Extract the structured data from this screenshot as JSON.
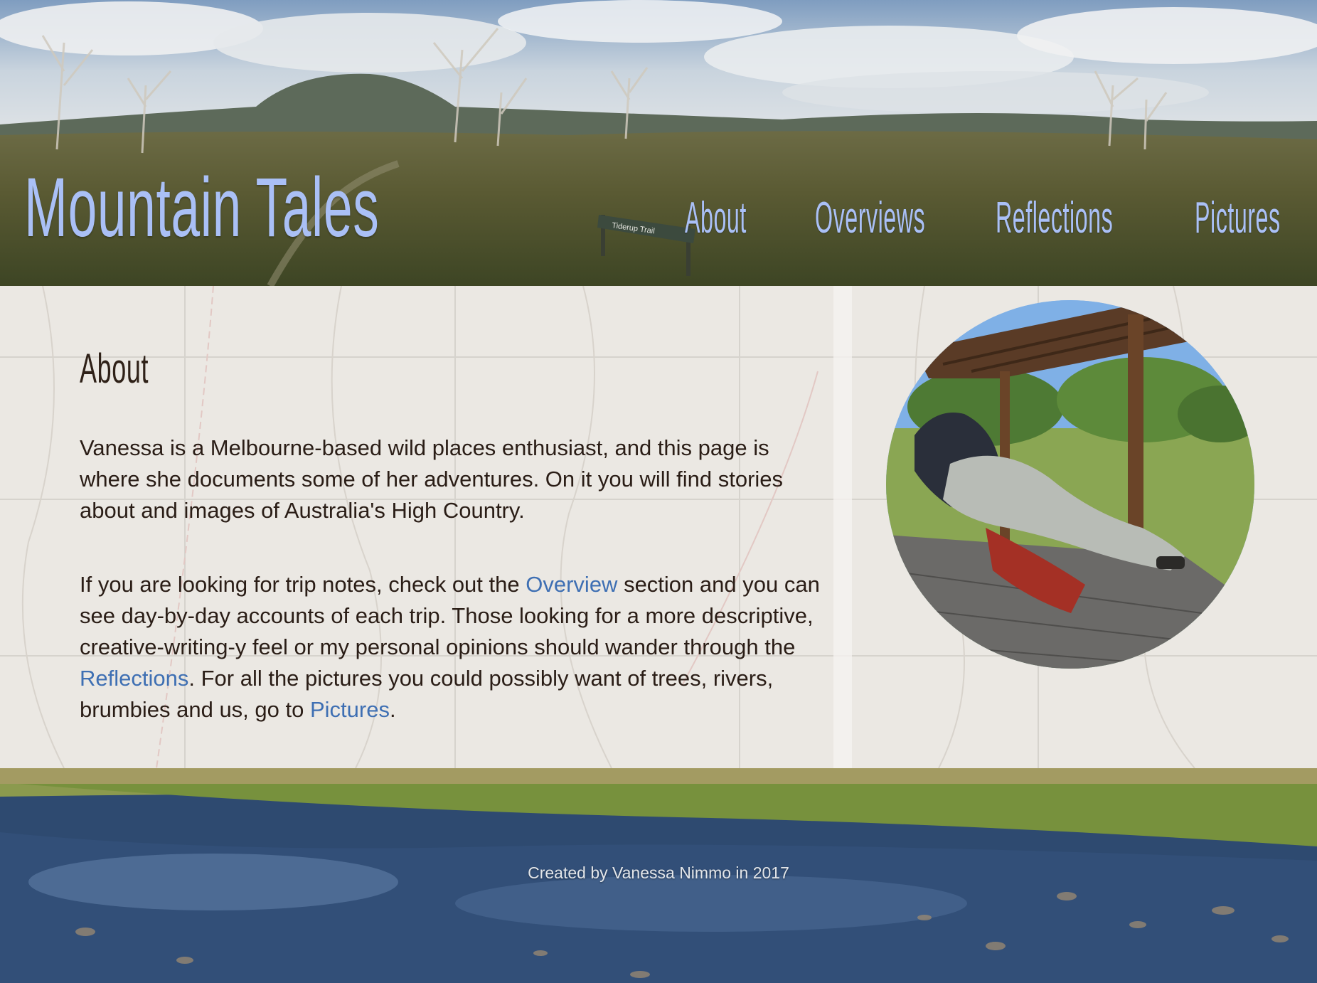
{
  "site": {
    "title": "Mountain Tales"
  },
  "nav": {
    "items": [
      {
        "label": "About"
      },
      {
        "label": "Overviews"
      },
      {
        "label": "Reflections"
      },
      {
        "label": "Pictures"
      }
    ]
  },
  "header_sign": {
    "text": "Tiderup Trail"
  },
  "about": {
    "heading": "About",
    "paragraph1": "Vanessa is a Melbourne-based wild places enthusiast, and this page is where she documents some of her adventures. On it you will find stories about and images of Australia's High Country.",
    "paragraph2": {
      "part1": "If you are looking for trip notes, check out the ",
      "link1": "Overview",
      "part2": " section and you can see day-by-day accounts of each trip. Those looking for a more descriptive, creative-writing-y feel or my personal opinions should wander through the ",
      "link2": "Reflections",
      "part3": ". For all the pictures you could possibly want of trees, rivers, brumbies and us, go to ",
      "link3": "Pictures",
      "part4": "."
    }
  },
  "footer": {
    "credit": "Created by Vanessa Nimmo in 2017"
  },
  "colors": {
    "title_accent": "#aac0f6",
    "link": "#3e6fb3",
    "body_text": "#2a1d16"
  }
}
